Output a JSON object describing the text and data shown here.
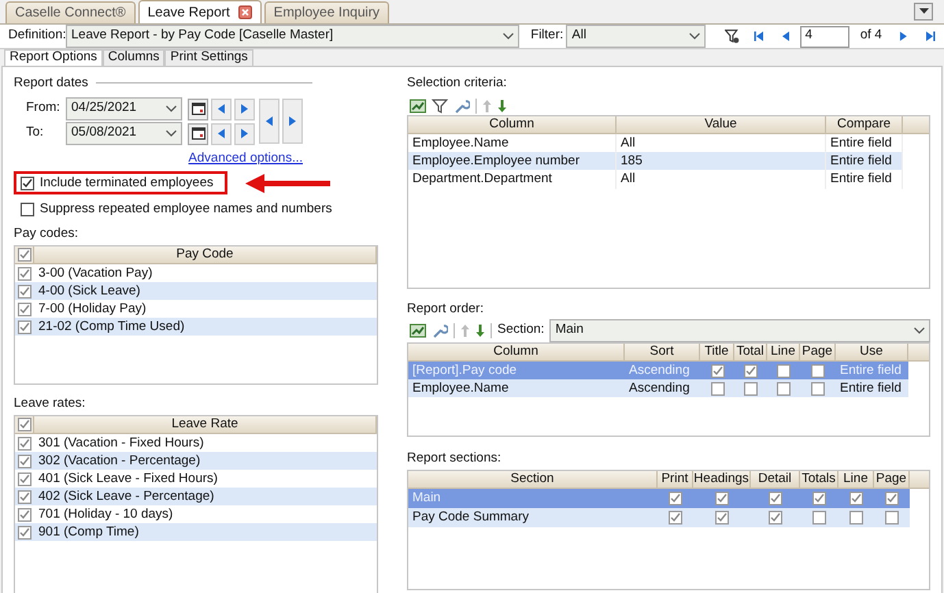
{
  "document_tabs": [
    {
      "label": "Caselle Connect®",
      "selected": false,
      "closable": false
    },
    {
      "label": "Leave Report",
      "selected": true,
      "closable": true
    },
    {
      "label": "Employee Inquiry",
      "selected": false,
      "closable": false
    }
  ],
  "definition": {
    "label": "Definition:",
    "value": "Leave Report - by Pay Code [Caselle Master]"
  },
  "filter": {
    "label": "Filter:",
    "value": "All"
  },
  "navigator": {
    "page": "4",
    "of": "of 4"
  },
  "option_tabs": [
    {
      "label": "Report Options",
      "selected": true
    },
    {
      "label": "Columns",
      "selected": false
    },
    {
      "label": "Print Settings",
      "selected": false
    }
  ],
  "report_dates": {
    "title": "Report dates",
    "from": {
      "label": "From:",
      "value": "04/25/2021"
    },
    "to": {
      "label": "To:",
      "value": "05/08/2021"
    }
  },
  "advanced_link": "Advanced options...",
  "options": [
    {
      "label": "Include terminated employees",
      "checked": true,
      "highlighted": true
    },
    {
      "label": "Suppress repeated employee names and numbers",
      "checked": false,
      "highlighted": false
    }
  ],
  "pay_codes": {
    "label": "Pay codes:",
    "header": "Pay Code",
    "all_checked": true,
    "rows": [
      {
        "label": "3-00 (Vacation Pay)",
        "checked": true
      },
      {
        "label": "4-00 (Sick Leave)",
        "checked": true
      },
      {
        "label": "7-00 (Holiday Pay)",
        "checked": true
      },
      {
        "label": "21-02 (Comp Time Used)",
        "checked": true
      }
    ]
  },
  "leave_rates": {
    "label": "Leave rates:",
    "header": "Leave Rate",
    "all_checked": true,
    "rows": [
      {
        "label": "301 (Vacation - Fixed Hours)",
        "checked": true
      },
      {
        "label": "302 (Vacation - Percentage)",
        "checked": true
      },
      {
        "label": "401 (Sick Leave - Fixed Hours)",
        "checked": true
      },
      {
        "label": "402 (Sick Leave - Percentage)",
        "checked": true
      },
      {
        "label": "701 (Holiday - 10 days)",
        "checked": true
      },
      {
        "label": "901 (Comp Time)",
        "checked": true
      }
    ]
  },
  "selection_criteria": {
    "label": "Selection criteria:",
    "columns": [
      "Column",
      "Value",
      "Compare"
    ],
    "rows": [
      {
        "cells": [
          "Employee.Name",
          "All",
          "Entire field"
        ]
      },
      {
        "cells": [
          "Employee.Employee number",
          "185",
          "Entire field"
        ]
      },
      {
        "cells": [
          "Department.Department",
          "All",
          "Entire field"
        ]
      }
    ]
  },
  "report_order": {
    "label": "Report order:",
    "section_label": "Section:",
    "section_value": "Main",
    "columns": [
      "Column",
      "Sort",
      "Title",
      "Total",
      "Line",
      "Page",
      "Use"
    ],
    "rows": [
      {
        "column": "[Report].Pay code",
        "sort": "Ascending",
        "title": true,
        "total": true,
        "line": false,
        "page": false,
        "use": "Entire field",
        "selected": true
      },
      {
        "column": "Employee.Name",
        "sort": "Ascending",
        "title": false,
        "total": false,
        "line": false,
        "page": false,
        "use": "Entire field",
        "selected": false
      }
    ]
  },
  "report_sections": {
    "label": "Report sections:",
    "columns": [
      "Section",
      "Print",
      "Headings",
      "Detail",
      "Totals",
      "Line",
      "Page"
    ],
    "rows": [
      {
        "section": "Main",
        "print": true,
        "headings": true,
        "detail": true,
        "totals": true,
        "line": true,
        "page": true,
        "selected": true
      },
      {
        "section": "Pay Code Summary",
        "print": true,
        "headings": true,
        "detail": true,
        "totals": false,
        "line": false,
        "page": false,
        "selected": false
      }
    ]
  }
}
